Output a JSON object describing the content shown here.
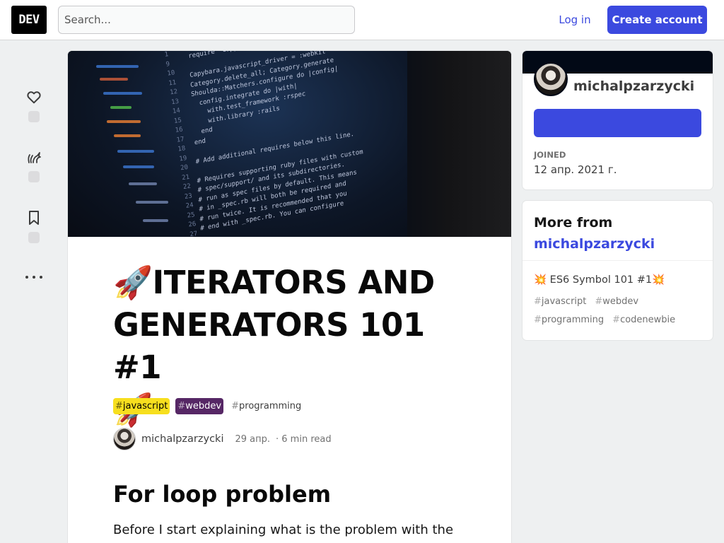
{
  "header": {
    "logo": "DEV",
    "search_placeholder": "Search...",
    "login_label": "Log in",
    "create_account_label": "Create account"
  },
  "article": {
    "title_emoji": "🚀",
    "title": "ITERATORS AND GENERATORS 101 #1",
    "tags": [
      "javascript",
      "webdev",
      "programming"
    ],
    "tag_colors": {
      "javascript": "#f7df1e",
      "webdev": "#562765"
    },
    "author": "michalpzarzycki",
    "date": "29 апр.",
    "read_time": "6 min read",
    "section_heading": "For loop problem",
    "body_first_line": "Before I start explaining what is the problem with the for"
  },
  "sidebar": {
    "profile": {
      "name": "michalpzarzycki",
      "joined_label": "JOINED",
      "joined_value": "12 апр. 2021 г."
    },
    "more_from": {
      "heading_prefix": "More from",
      "heading_link": "michalpzarzycki",
      "post_title": "💥 ES6 Symbol 101 #1💥",
      "post_tags": [
        "javascript",
        "webdev",
        "programming",
        "codenewbie"
      ]
    }
  },
  "icons": {
    "reaction_heart": "heart-icon",
    "reaction_unicorn": "unicorn-icon",
    "reaction_bookmark": "bookmark-icon",
    "more_options": "more-horizontal-icon"
  },
  "colors": {
    "accent": "#3b49df",
    "page_bg": "#eef0f1",
    "profile_band": "#020916"
  }
}
